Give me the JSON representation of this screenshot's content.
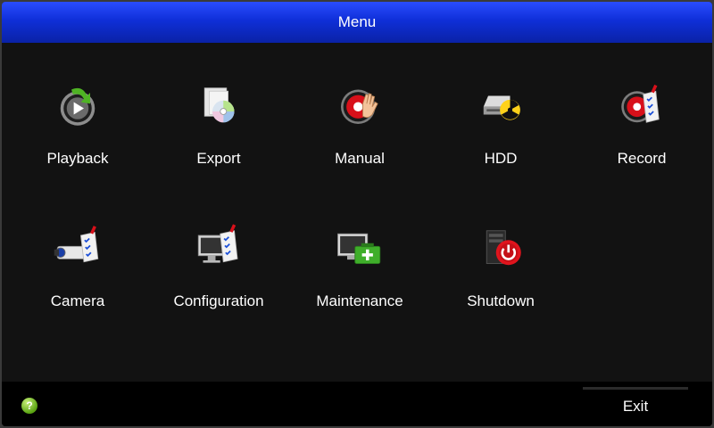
{
  "window": {
    "title": "Menu"
  },
  "menu": {
    "items": [
      {
        "label": "Playback",
        "icon": "playback-icon"
      },
      {
        "label": "Export",
        "icon": "export-disc-icon"
      },
      {
        "label": "Manual",
        "icon": "manual-record-hand-icon"
      },
      {
        "label": "HDD",
        "icon": "hdd-icon"
      },
      {
        "label": "Record",
        "icon": "record-checklist-icon"
      },
      {
        "label": "Camera",
        "icon": "camera-checklist-icon"
      },
      {
        "label": "Configuration",
        "icon": "configuration-checklist-icon"
      },
      {
        "label": "Maintenance",
        "icon": "maintenance-toolbox-icon"
      },
      {
        "label": "Shutdown",
        "icon": "shutdown-power-icon"
      }
    ]
  },
  "footer": {
    "help_icon": "help-icon",
    "help_symbol": "?",
    "exit_label": "Exit"
  },
  "colors": {
    "titlebar": "#0f2fd8",
    "background": "#121212",
    "footer": "#000000",
    "record_red": "#d8101a",
    "help_green": "#5aa412"
  }
}
